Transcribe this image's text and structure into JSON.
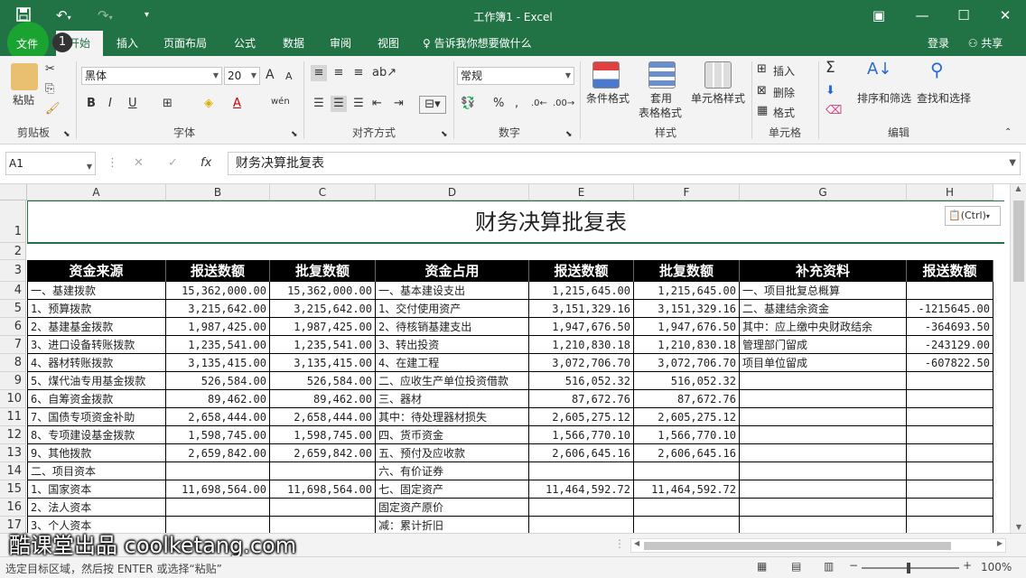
{
  "window": {
    "title": "工作簿1 - Excel"
  },
  "tabs": [
    {
      "label": "文件"
    },
    {
      "label": "开始"
    },
    {
      "label": "插入"
    },
    {
      "label": "页面布局"
    },
    {
      "label": "公式"
    },
    {
      "label": "数据"
    },
    {
      "label": "审阅"
    },
    {
      "label": "视图"
    }
  ],
  "tell_me": "告诉我你想要做什么",
  "login": "登录",
  "share": "共享",
  "step_badge": "1",
  "ribbon": {
    "clipboard": {
      "paste": "粘贴",
      "label": "剪贴板"
    },
    "font": {
      "name": "黑体",
      "size": "20",
      "label": "字体",
      "bold": "B",
      "italic": "I",
      "underline": "U",
      "grow": "A",
      "shrink": "A",
      "pinyin": "wén"
    },
    "alignment": {
      "label": "对齐方式"
    },
    "number": {
      "format": "常规",
      "label": "数字",
      "percent": "%",
      "comma": ","
    },
    "styles": {
      "conditional": "条件格式",
      "table": "套用",
      "table2": "表格格式",
      "cell": "单元格样式",
      "label": "样式"
    },
    "cells": {
      "insert": "插入",
      "delete": "删除",
      "format": "格式",
      "label": "单元格"
    },
    "editing": {
      "sort": "排序和筛选",
      "find": "查找和选择",
      "label": "编辑"
    }
  },
  "formula_bar": {
    "name_box": "A1",
    "fx": "fx",
    "content": "财务决算批复表"
  },
  "columns": [
    "A",
    "B",
    "C",
    "D",
    "E",
    "F",
    "G",
    "H"
  ],
  "rows": [
    "1",
    "2",
    "3",
    "4",
    "5",
    "6",
    "7",
    "8",
    "9",
    "10",
    "11",
    "12",
    "13",
    "14",
    "15",
    "16",
    "17"
  ],
  "sheet": {
    "title": "财务决算批复表",
    "paste_options": "(Ctrl)",
    "headers": [
      "资金来源",
      "报送数额",
      "批复数额",
      "资金占用",
      "报送数额",
      "批复数额",
      "补充资料",
      "报送数额"
    ],
    "data": [
      [
        "一、基建拨款",
        "15,362,000.00",
        "15,362,000.00",
        "一、基本建设支出",
        "1,215,645.00",
        "1,215,645.00",
        "一、项目批复总概算",
        ""
      ],
      [
        " 1、预算拨款",
        "3,215,642.00",
        "3,215,642.00",
        " 1、交付使用资产",
        "3,151,329.16",
        "3,151,329.16",
        "二、基建结余资金",
        "-1215645.00"
      ],
      [
        " 2、基建基金拨款",
        "1,987,425.00",
        "1,987,425.00",
        " 2、待核销基建支出",
        "1,947,676.50",
        "1,947,676.50",
        "  其中：应上缴中央财政结余",
        "-364693.50"
      ],
      [
        " 3、进口设备转账拨款",
        "1,235,541.00",
        "1,235,541.00",
        " 3、转出投资",
        "1,210,830.18",
        "1,210,830.18",
        "      管理部门留成",
        "-243129.00"
      ],
      [
        " 4、器材转账拨款",
        "3,135,415.00",
        "3,135,415.00",
        " 4、在建工程",
        "3,072,706.70",
        "3,072,706.70",
        "      项目单位留成",
        "-607822.50"
      ],
      [
        " 5、煤代油专用基金拨款",
        "526,584.00",
        "526,584.00",
        "二、应收生产单位投资借款",
        "516,052.32",
        "516,052.32",
        "",
        ""
      ],
      [
        " 6、自筹资金拨款",
        "89,462.00",
        "89,462.00",
        "三、器材",
        "87,672.76",
        "87,672.76",
        "",
        ""
      ],
      [
        " 7、国债专项资金补助",
        "2,658,444.00",
        "2,658,444.00",
        "    其中：待处理器材损失",
        "2,605,275.12",
        "2,605,275.12",
        "",
        ""
      ],
      [
        " 8、专项建设基金拨款",
        "1,598,745.00",
        "1,598,745.00",
        "四、货币资金",
        "1,566,770.10",
        "1,566,770.10",
        "",
        ""
      ],
      [
        " 9、其他拨款",
        "2,659,842.00",
        "2,659,842.00",
        "五、预付及应收款",
        "2,606,645.16",
        "2,606,645.16",
        "",
        ""
      ],
      [
        "二、项目资本",
        "",
        "",
        "六、有价证券",
        "",
        "",
        "",
        ""
      ],
      [
        " 1、国家资本",
        "11,698,564.00",
        "11,698,564.00",
        "七、固定资产",
        "11,464,592.72",
        "11,464,592.72",
        "",
        ""
      ],
      [
        " 2、法人资本",
        "",
        "",
        "    固定资产原价",
        "",
        "",
        "",
        ""
      ],
      [
        " 3、个人资本",
        "",
        "",
        "    减：累计折旧",
        "",
        "",
        "",
        ""
      ]
    ]
  },
  "watermark": "酷课堂出品 coolketang.com",
  "status": {
    "message": "选定目标区域，然后按 ENTER 或选择“粘贴”",
    "zoom": "100%"
  }
}
